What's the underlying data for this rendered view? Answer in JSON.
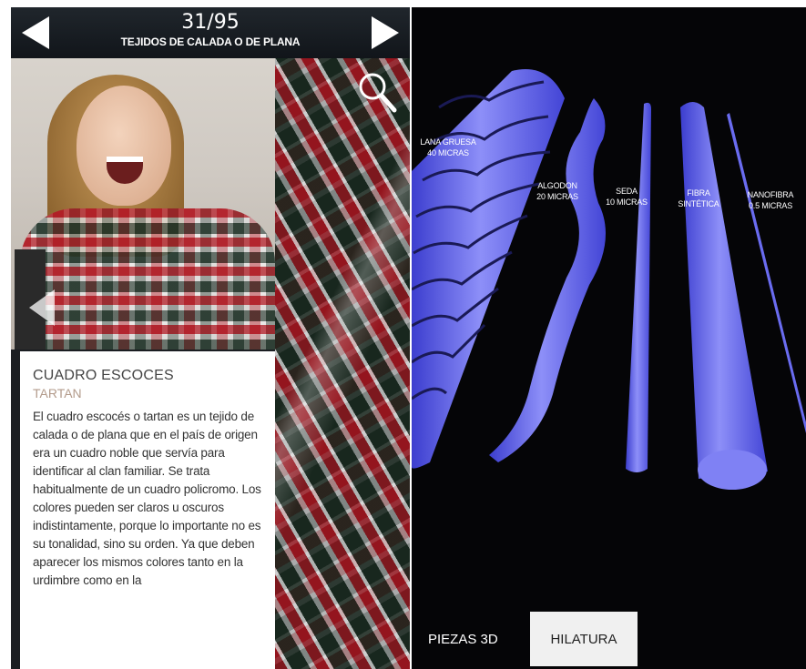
{
  "header": {
    "counter": "31/95",
    "section": "TEJIDOS DE CALADA O DE PLANA"
  },
  "icons": {
    "prev": "left-triangle-icon",
    "next": "right-triangle-icon",
    "search": "magnifier-icon",
    "back": "left-triangle-icon"
  },
  "card": {
    "title": "CUADRO ESCOCES",
    "subtitle": "TARTAN",
    "body": "El cuadro escocés o tartan es un tejido de calada o de plana que en el país de origen era un cuadro noble que servía para identificar al clan familiar. Se trata habitualmente de un cuadro policromo. Los colores pueden ser claros u oscuros indistintamente, porque lo importante no es su tonalidad, sino su orden. Ya que deben aparecer los mismos colores tanto en la urdimbre como en la"
  },
  "fibers": [
    {
      "name": "LANA GRUESA",
      "size": "40 MICRAS"
    },
    {
      "name": "ALGODON",
      "size": "20 MICRAS"
    },
    {
      "name": "SEDA",
      "size": "10 MICRAS"
    },
    {
      "name": "FIBRA",
      "size": "SINTÉTICA"
    },
    {
      "name": "NANOFIBRA",
      "size": "0.5 MICRAS"
    }
  ],
  "tabs": {
    "pieces3d": "PIEZAS 3D",
    "hilatura": "HILATURA"
  },
  "colors": {
    "fiber": "#6a6cf0",
    "header_bg": "#161a1f",
    "card_subtitle": "#b39b8b"
  }
}
